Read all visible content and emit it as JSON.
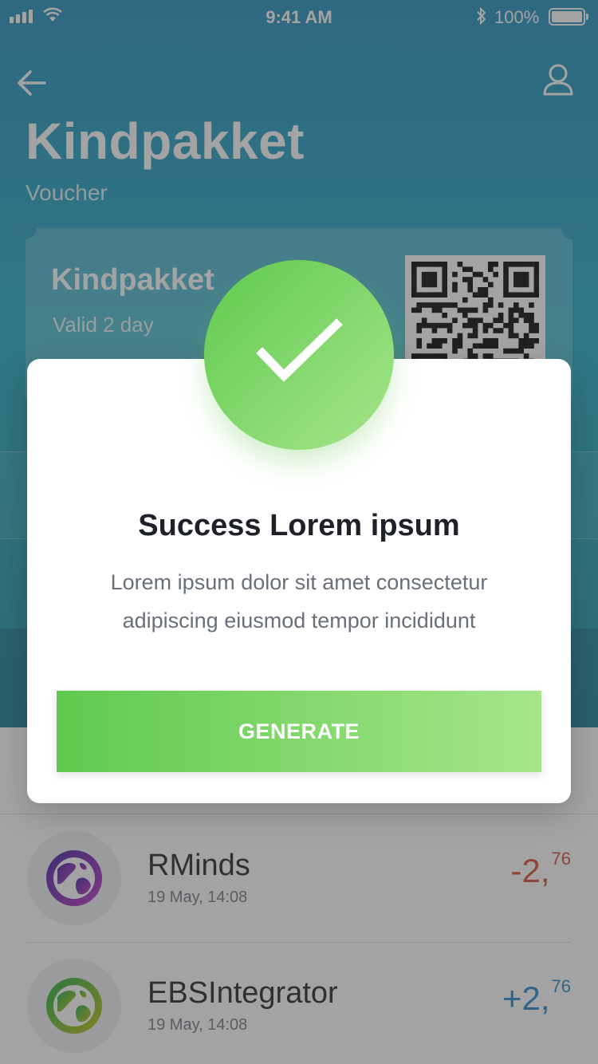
{
  "status_bar": {
    "time": "9:41 AM",
    "battery_percent": "100%"
  },
  "header": {
    "title": "Kindpakket",
    "subtitle": "Voucher",
    "back_icon": "arrow-left-icon",
    "profile_icon": "user-icon"
  },
  "voucher": {
    "title": "Kindpakket",
    "validity": "Valid 2 day"
  },
  "transactions": [
    {
      "name": "RMinds",
      "date": "19 May, 14:08",
      "amount_main": "-2,",
      "amount_cents": "76",
      "color": "#d9573f"
    },
    {
      "name": "EBSIntegrator",
      "date": "19 May, 14:08",
      "amount_main": "+2,",
      "amount_cents": "76",
      "color": "#2e8fcf"
    }
  ],
  "modal": {
    "icon": "checkmark-icon",
    "title": "Success Lorem ipsum",
    "message": "Lorem ipsum dolor sit amet consectetur adipiscing eiusmod tempor incididunt",
    "button_label": "GENERATE"
  },
  "colors": {
    "success_start": "#5fca4e",
    "success_end": "#a6e58b",
    "header": "#2da4c6"
  }
}
